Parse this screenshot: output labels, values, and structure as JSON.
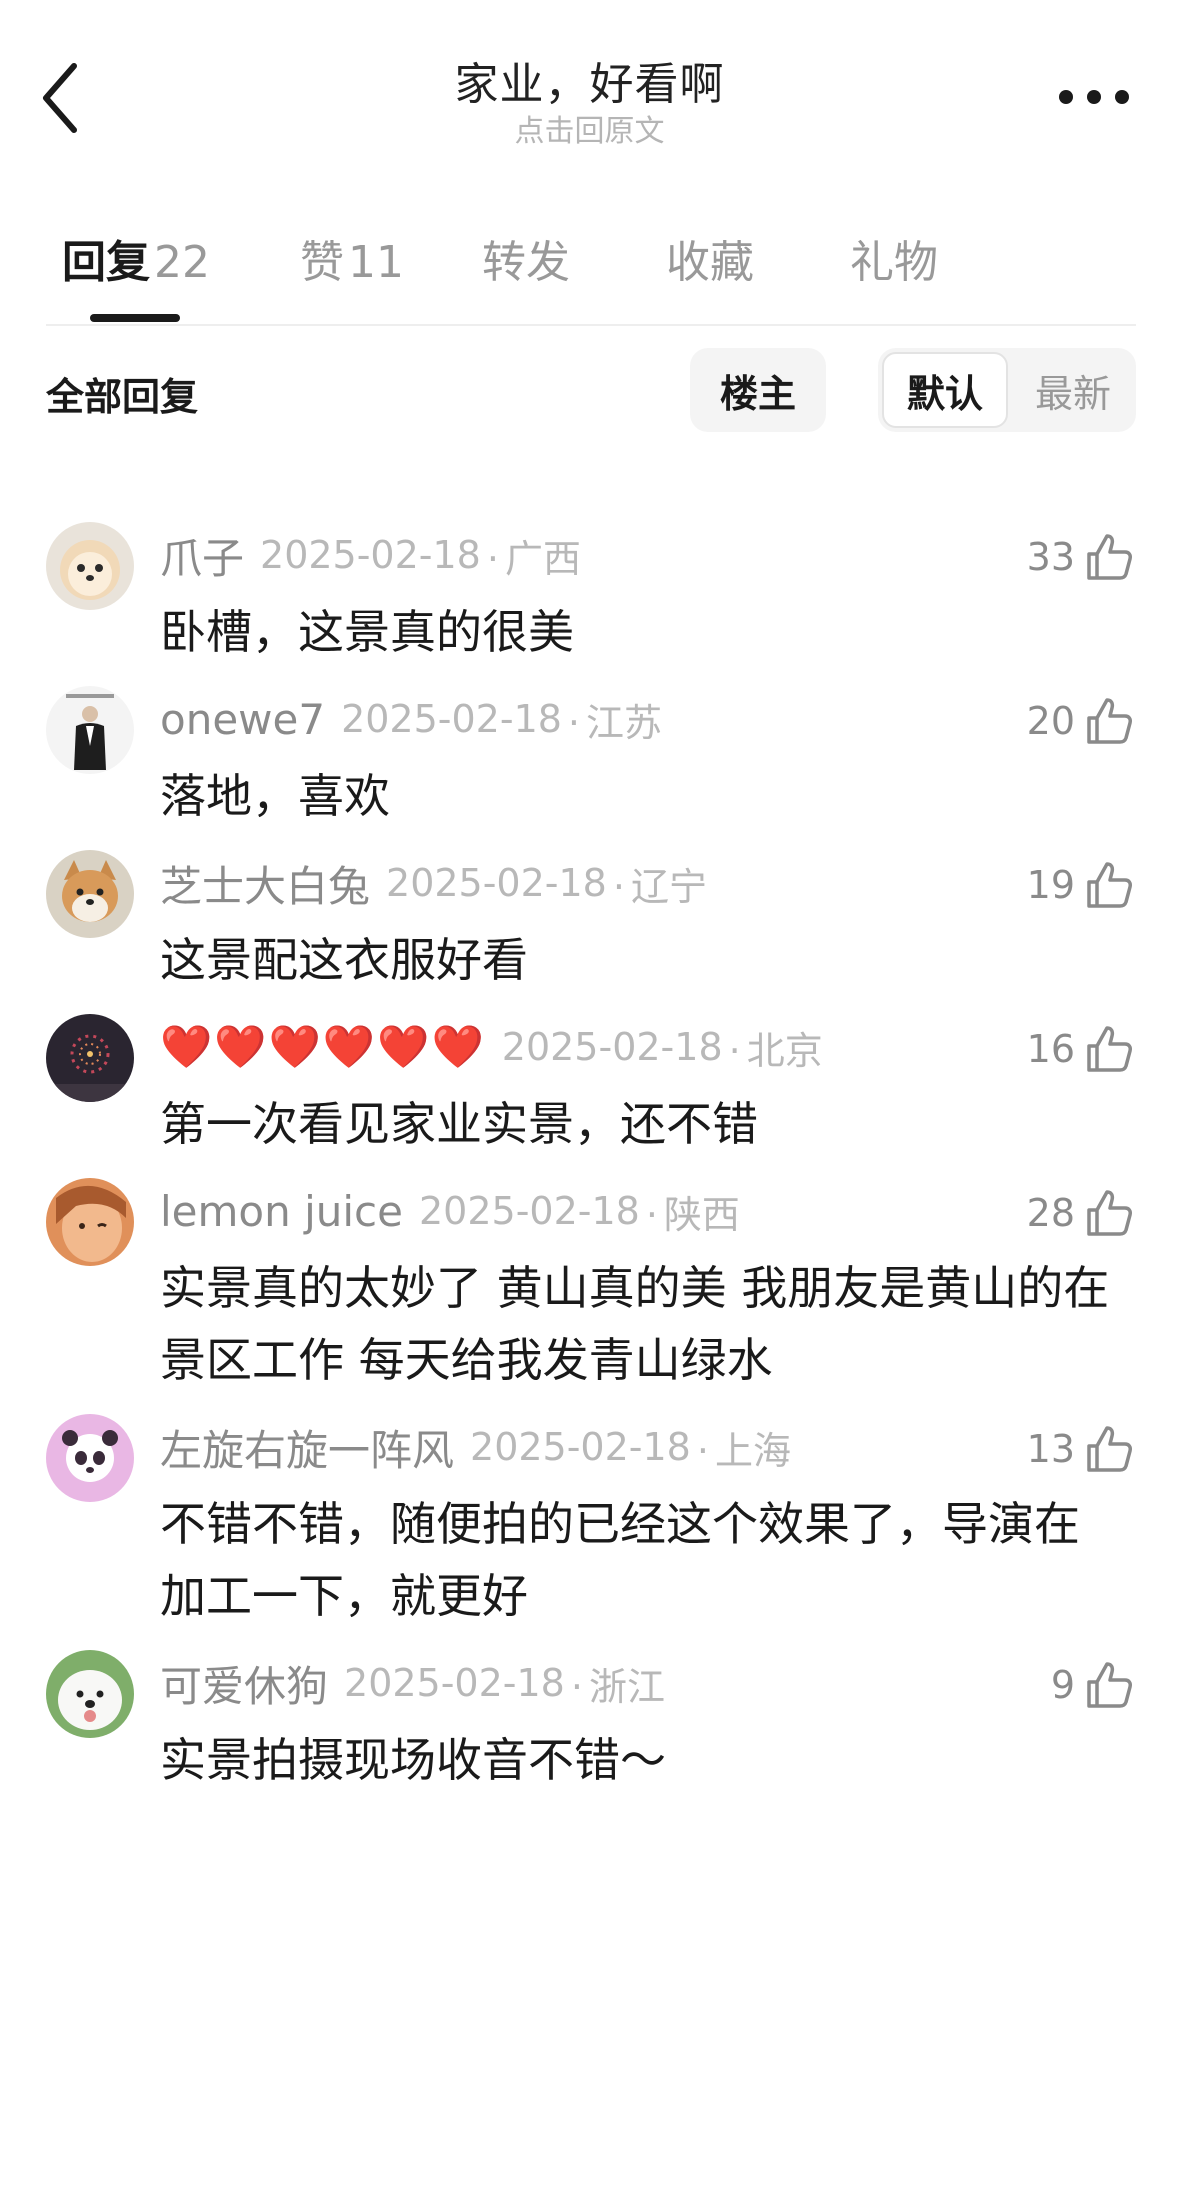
{
  "header": {
    "title": "家业，好看啊",
    "subtitle": "点击回原文"
  },
  "tabs": [
    {
      "label": "回复",
      "count": "22",
      "active": true
    },
    {
      "label": "赞",
      "count": "11",
      "active": false
    },
    {
      "label": "转发",
      "count": "",
      "active": false
    },
    {
      "label": "收藏",
      "count": "",
      "active": false
    },
    {
      "label": "礼物",
      "count": "",
      "active": false
    }
  ],
  "filter": {
    "title": "全部回复",
    "owner_label": "楼主",
    "sort_default": "默认",
    "sort_latest": "最新",
    "selected_sort": "默认"
  },
  "comments": [
    {
      "user": "爪子",
      "time": "2025-02-18",
      "location": "广西",
      "likes": "33",
      "text": "卧槽，这景真的很美",
      "avatar": "pomeranian-avatar"
    },
    {
      "user": "onewe7",
      "time": "2025-02-18",
      "location": "江苏",
      "likes": "20",
      "text": "落地，喜欢",
      "avatar": "person-photo-avatar"
    },
    {
      "user": "芝士大白兔",
      "time": "2025-02-18",
      "location": "辽宁",
      "likes": "19",
      "text": "这景配这衣服好看",
      "avatar": "shiba-avatar"
    },
    {
      "user": "❤️❤️❤️❤️❤️❤️",
      "time": "2025-02-18",
      "location": "北京",
      "likes": "16",
      "text": "第一次看见家业实景，还不错",
      "avatar": "fireworks-avatar"
    },
    {
      "user": "lemon juice",
      "time": "2025-02-18",
      "location": "陕西",
      "likes": "28",
      "text": "实景真的太妙了 黄山真的美 我朋友是黄山的在景区工作  每天给我发青山绿水",
      "avatar": "selfie-avatar"
    },
    {
      "user": "左旋右旋一阵风",
      "time": "2025-02-18",
      "location": "上海",
      "likes": "13",
      "text": "不错不错，随便拍的已经这个效果了，导演在加工一下，就更好",
      "avatar": "panda-avatar"
    },
    {
      "user": "可爱休狗",
      "time": "2025-02-18",
      "location": "浙江",
      "likes": "9",
      "text": "实景拍摄现场收音不错～",
      "avatar": "samoyed-avatar"
    }
  ],
  "colors": {
    "primary_text": "#1a1a1a",
    "secondary_text": "#8a8a8a",
    "meta_text": "#b8b8b8",
    "heart_red": "#e21d2b"
  }
}
